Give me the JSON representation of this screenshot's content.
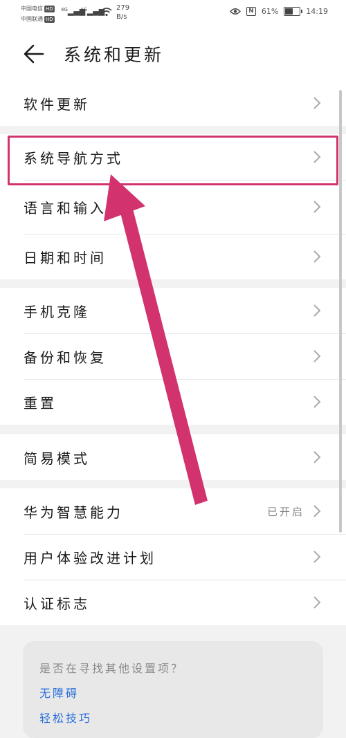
{
  "status_bar": {
    "carrier1": "中国电信",
    "carrier2": "中国联通",
    "hd": "HD",
    "signal1": "4G",
    "signal2": "4G",
    "speed_value": "279",
    "speed_unit": "B/s",
    "battery_text": "61%",
    "battery_level": 0.61,
    "time": "14:19"
  },
  "header": {
    "title": "系统和更新"
  },
  "groups": [
    {
      "items": [
        {
          "label": "软件更新"
        }
      ]
    },
    {
      "items": [
        {
          "label": "系统导航方式"
        },
        {
          "label": "语言和输入法"
        },
        {
          "label": "日期和时间"
        }
      ]
    },
    {
      "items": [
        {
          "label": "手机克隆"
        },
        {
          "label": "备份和恢复"
        },
        {
          "label": "重置"
        }
      ]
    },
    {
      "items": [
        {
          "label": "简易模式"
        }
      ]
    },
    {
      "items": [
        {
          "label": "华为智慧能力",
          "value": "已开启"
        },
        {
          "label": "用户体验改进计划"
        },
        {
          "label": "认证标志"
        }
      ]
    }
  ],
  "suggestion_card": {
    "question": "是否在寻找其他设置项？",
    "link1": "无障碍",
    "link2": "轻松技巧"
  },
  "colors": {
    "annotation": "#d2336f",
    "link": "#2a6fdb"
  }
}
